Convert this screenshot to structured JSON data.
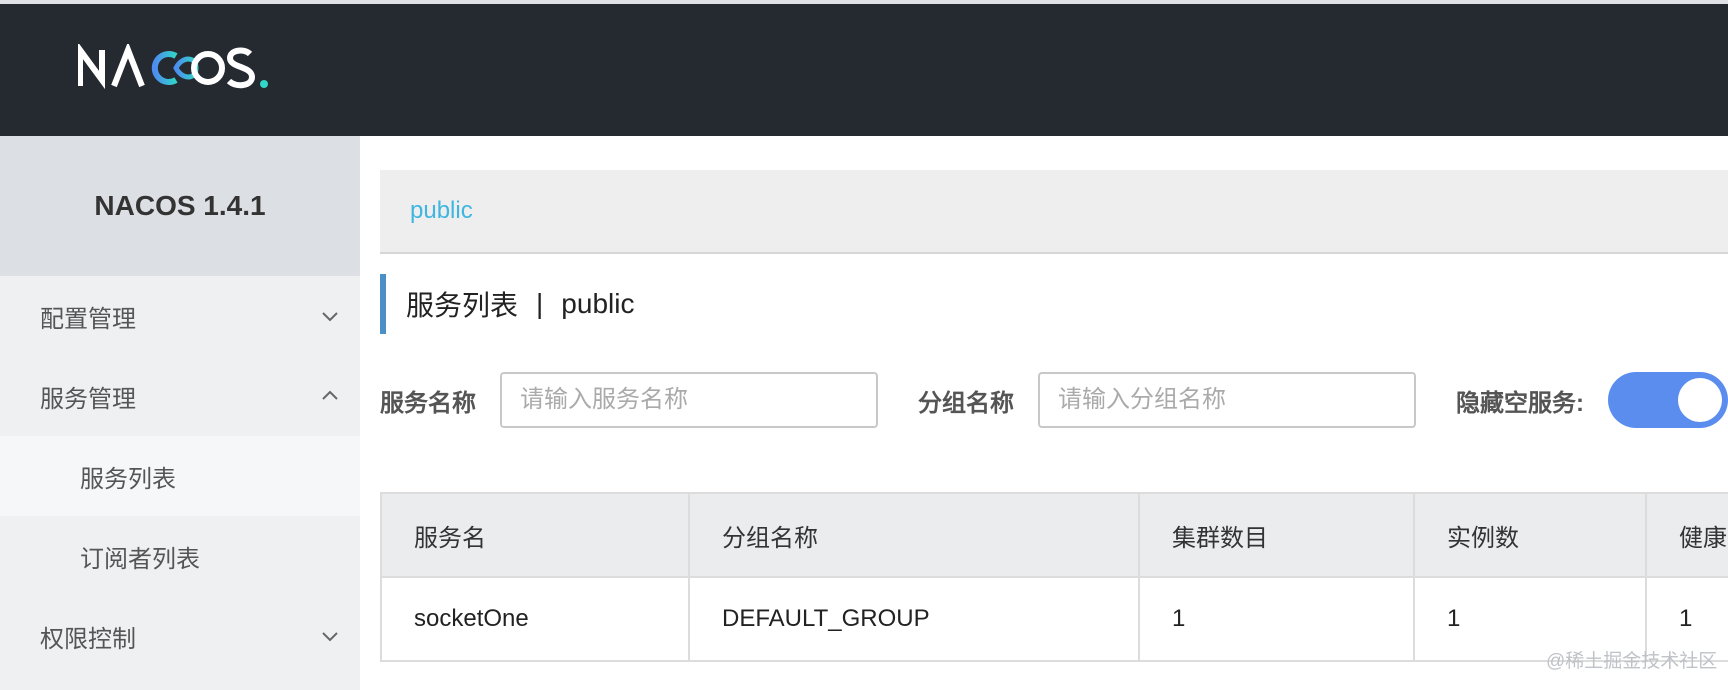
{
  "header": {
    "logo_text": "NACOS."
  },
  "sidebar": {
    "version_title": "NACOS 1.4.1",
    "items": [
      {
        "label": "配置管理",
        "expanded": false
      },
      {
        "label": "服务管理",
        "expanded": true,
        "children": [
          {
            "label": "服务列表",
            "active": true
          },
          {
            "label": "订阅者列表",
            "active": false
          }
        ]
      },
      {
        "label": "权限控制",
        "expanded": false
      }
    ]
  },
  "namespace": {
    "current": "public"
  },
  "page_title": {
    "section": "服务列表",
    "separator": "|",
    "namespace": "public"
  },
  "filters": {
    "service_name_label": "服务名称",
    "service_name_placeholder": "请输入服务名称",
    "group_name_label": "分组名称",
    "group_name_placeholder": "请输入分组名称",
    "hide_empty_label": "隐藏空服务:",
    "hide_empty_on": true
  },
  "table": {
    "columns": [
      "服务名",
      "分组名称",
      "集群数目",
      "实例数",
      "健康"
    ],
    "rows": [
      [
        "socketOne",
        "DEFAULT_GROUP",
        "1",
        "1",
        "1"
      ]
    ]
  },
  "watermark": "@稀土掘金技术社区",
  "colors": {
    "accent": "#3fb6e0",
    "toggle": "#5b8def",
    "header_bg": "#252a30"
  }
}
